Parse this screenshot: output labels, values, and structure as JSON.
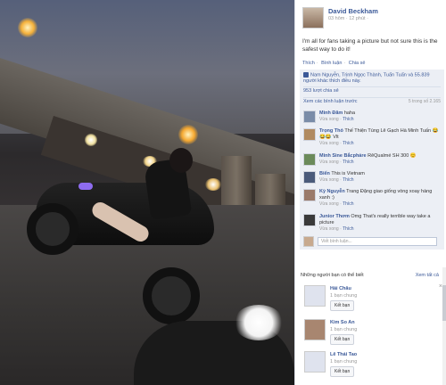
{
  "post": {
    "author": "David Beckham",
    "time": "03 hôm · 12 phút ·",
    "caption": "I'm all for fans taking a picture but not sure this is the safest way to do it!",
    "actions": {
      "like": "Thích",
      "comment": "Bình luận",
      "share": "Chia sẻ"
    },
    "likes_text": "Nam Nguyễn, Trịnh Ngọc Thành, Tuấn Tuấn và 55.839 người khác thích điều này.",
    "shares_text": "953 lượt chia sẻ",
    "previous_comments": "Xem các bình luận trước",
    "comment_count": "5 trong số 2.165",
    "comment_placeholder": "Viết bình luận..."
  },
  "comments": [
    {
      "author": "Minh Đăm",
      "text": "haha",
      "time": "Vừa xong"
    },
    {
      "author": "Trọng Thỏ",
      "text": "Thế Thiện Tùng Lê Gạch Hà Minh Tuấn 😂😂😂 Vlt",
      "time": "Vừa xong"
    },
    {
      "author": "Minh Sine Bắcpháre",
      "text": "RêQualmé SH 300 😊",
      "time": "Vừa xong"
    },
    {
      "author": "Biển",
      "text": "This is Vietnam",
      "time": "Vừa xong"
    },
    {
      "author": "Kỳ Nguyễn",
      "text": "Trang Đặng giao giống vòng xoay hàng xanh :)",
      "time": "Vừa xong"
    },
    {
      "author": "Junior Thơm",
      "text": "Omg That's really terrible way take a picture",
      "time": "Vừa xong"
    }
  ],
  "comment_like_label": "Thích",
  "pymk": {
    "heading": "Những người bạn có thể biết",
    "see_all": "Xem tất cả",
    "close": "×",
    "people": [
      {
        "name": "Hải Châu",
        "mutual": "1 bạn chung",
        "button": "Kết bạn"
      },
      {
        "name": "Kim So An",
        "mutual": "1 bạn chung",
        "button": "Kết bạn"
      },
      {
        "name": "Lê Thái Tao",
        "mutual": "1 bạn chung",
        "button": "Kết bạn"
      }
    ]
  },
  "colors": {
    "link": "#3b5998",
    "panel": "#eceff5"
  }
}
